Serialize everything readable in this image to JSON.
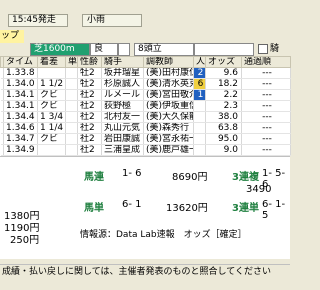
{
  "header": {
    "time": "15:45発走",
    "weather": "小雨",
    "cup_label": "ップ"
  },
  "conditions": {
    "course": "芝1600m",
    "track": "良",
    "heads": "8頭立",
    "checkbox_label": "騎"
  },
  "table": {
    "columns": [
      "",
      "タイム",
      "着差",
      "単",
      "性齢",
      "騎手",
      "調教師",
      "人",
      "オッズ",
      "通過順"
    ],
    "rows": [
      {
        "c0": "",
        "time": "1.33.8",
        "margin": "",
        "b": "",
        "sex": "牡2",
        "jockey": "坂井瑠星",
        "trainer": "(美)田村康仁",
        "pop": "2",
        "odds": "9.6",
        "pass": "---"
      },
      {
        "c0": "",
        "time": "1.34.0",
        "margin": "1 1/2",
        "b": "",
        "sex": "牡2",
        "jockey": "杉原誠人",
        "trainer": "(美)清水英克",
        "pop": "6",
        "odds": "18.2",
        "pass": "---"
      },
      {
        "c0": "",
        "time": "1.34.1",
        "margin": "クビ",
        "b": "",
        "sex": "社2",
        "jockey": "ルメール",
        "trainer": "(美)宮田敬介",
        "pop": "1",
        "odds": "2.2",
        "pass": "---"
      },
      {
        "c0": "",
        "time": "1.34.1",
        "margin": "クビ",
        "b": "",
        "sex": "社2",
        "jockey": "荻野極",
        "trainer": "(美)伊坂重信",
        "pop": "",
        "odds": "2.3",
        "pass": "---"
      },
      {
        "c0": "",
        "time": "1.34.4",
        "margin": "1 3/4",
        "b": "",
        "sex": "社2",
        "jockey": "北村友一",
        "trainer": "(美)大久保龍",
        "pop": "",
        "odds": "38.0",
        "pass": "---"
      },
      {
        "c0": "",
        "time": "1.34.6",
        "margin": "1 1/4",
        "b": "",
        "sex": "社2",
        "jockey": "丸山元気",
        "trainer": "(美)森秀行",
        "pop": "",
        "odds": "63.8",
        "pass": "---"
      },
      {
        "c0": "",
        "time": "1.34.7",
        "margin": "クビ",
        "b": "",
        "sex": "社2",
        "jockey": "岩田康誠",
        "trainer": "(美)宮永祐一",
        "pop": "",
        "odds": "95.0",
        "pass": "---"
      },
      {
        "c0": "",
        "time": "1.34.9",
        "margin": "",
        "b": "",
        "sex": "社2",
        "jockey": "三浦皇成",
        "trainer": "(美)鹿戸雄一",
        "pop": "",
        "odds": "9.0",
        "pass": "---"
      }
    ]
  },
  "payout": {
    "umaren_label": "馬連",
    "umaren_combo": "1- 6",
    "umaren_amount": "8690円",
    "sanrenpuku_label": "3連複",
    "sanrenpuku_combo": "1- 5- 6",
    "sanrenpuku_amount": "3490",
    "umatan_label": "馬単",
    "umatan_combo": "6- 1",
    "umatan_amount": "13620円",
    "sanrentan_label": "3連単",
    "sanrentan_combo": "6- 1- 5",
    "left_amount1": "1380円",
    "left_amount2": "1190円",
    "left_amount3": "250円",
    "info": "情報源：Data Lab速報　オッズ［確定］"
  },
  "footer": {
    "text": "成績・払い戻しに関しては、主催者発表のものと照合してください"
  }
}
